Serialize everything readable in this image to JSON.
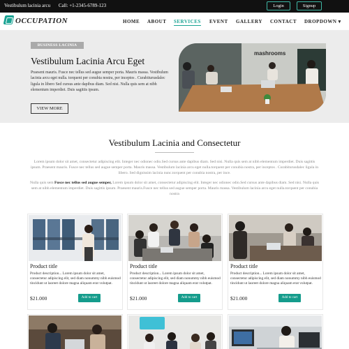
{
  "topbar": {
    "site_name": "Vestibulum lacinia arcu",
    "call": "Call:  +1-2345-6789-123",
    "login": "Login",
    "signup": "Signup"
  },
  "nav": {
    "logo": "OCCUPATION",
    "links": [
      "HOME",
      "ABOUT",
      "SERVICES",
      "EVENT",
      "GALLERY",
      "CONTACT",
      "DROPDOWN ▾"
    ],
    "active": "SERVICES"
  },
  "hero": {
    "badge": "BUSINESS LACINIA",
    "title": "Vestibulum Lacinia Arcu Eget",
    "text": "Praesent mauris. Fusce nec tellus sed augue semper porta. Mauris massa. Vestibulum lacinia arcu eget nulla. torquent per conubia nostra, per inceptos . Curabiturusdalec ligula in libero Sed cursus ante dapibus diam. Sed nisi. Nulla quis sem at nibh elementum imperdiet. Duis sagittis ipsum.",
    "button": "VIEW MORE",
    "image_sign": "mashrooms"
  },
  "section": {
    "title": "Vestibulum Lacinia and Consectetur",
    "p1": "Lorem ipsum dolor sit amet, consectetur adipiscing elit. Integer nec odionec odio.Sed cursus ante dapibus diam. Sed nisi. Nulla quis sem at nibh elementum imperdiet. Duis sagittis ipsum. Praesent mauris. Fusce nec tellus sed augue semper porta. Mauris massa. Vestibulum lacinia arcu eget nulla.torquent per conubia nostra, per inceptos . Curabiturusdalec ligula in libero. Sed dignissim lacinia nunc.torquent per conubia nostra, per ince.",
    "p2_lead": "Nulla quis sem",
    "p2_bold": "Fusce nec tellus sed augue semper,",
    "p2_rest": "Lorem ipsum dolor sit amet, consectetur adipiscing elit. Integer nec odionec odio.Sed cursus ante dapibus diam. Sed nisi. Nulla quis sem at nibh elementum imperdiet. Duis sagittis ipsum. Praesent mauris.Fusce nec tellus sed augue semper porta. Mauris massa. Vestibulum lacinia arcu eget nulla.torquent per conubia nostra"
  },
  "products": [
    {
      "title": "Product title",
      "desc": "Product description... Lorem ipsum dolor sit amet, consectetur adipiscing elit, sed diam nonummy nibh euismod tincidunt ut laoreet dolore magna aliquam erat volutpat.",
      "price": "$21.000",
      "button": "Add to cart"
    },
    {
      "title": "Product title",
      "desc": "Product description... Lorem ipsum dolor sit amet, consectetur adipiscing elit, sed diam nonummy nibh euismod tincidunt ut laoreet dolore magna aliquam erat volutpat.",
      "price": "$21.000",
      "button": "Add to cart"
    },
    {
      "title": "Product title",
      "desc": "Product description... Lorem ipsum dolor sit amet, consectetur adipiscing elit, sed diam nonummy nibh euismod tincidunt ut laoreet dolore magna aliquam erat volutpat.",
      "price": "$21.000",
      "button": "Add to cart"
    }
  ],
  "colors": {
    "accent": "#1aa393",
    "topbar": "#111111",
    "hero_bg": "#ececec"
  }
}
